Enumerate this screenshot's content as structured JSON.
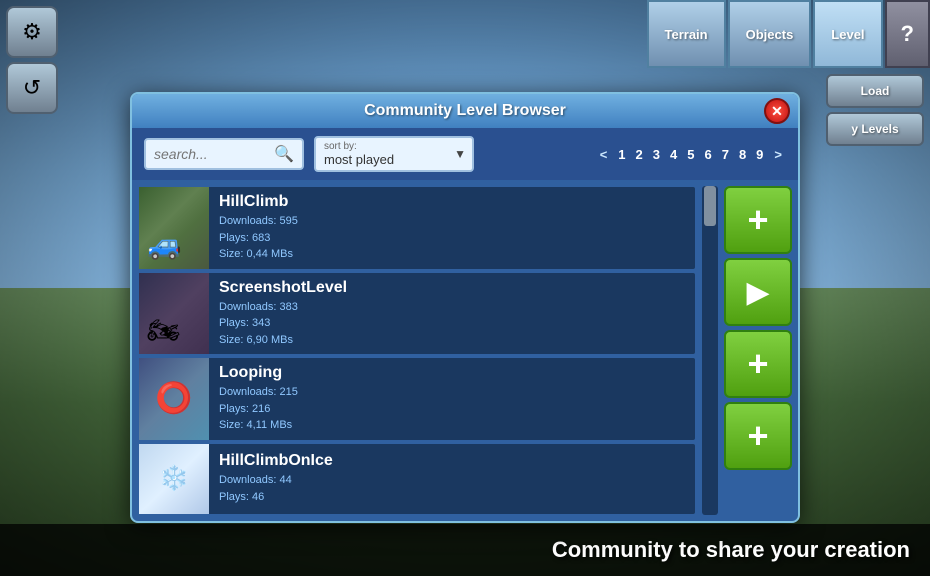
{
  "toolbar": {
    "terrain_label": "Terrain",
    "objects_label": "Objects",
    "level_label": "Level",
    "help_label": "?"
  },
  "sidebar": {
    "gear_icon": "⚙",
    "refresh_icon": "↺"
  },
  "right_panel": {
    "load_label": "Load",
    "my_levels_label": "y Levels"
  },
  "modal": {
    "title": "Community Level Browser",
    "close_label": "✕",
    "search_placeholder": "search...",
    "sort_label": "sort by:",
    "sort_value": "most played",
    "pagination": {
      "prev": "<",
      "pages": [
        "1",
        "2",
        "3",
        "4",
        "5",
        "6",
        "7",
        "8",
        "9"
      ],
      "next": ">"
    }
  },
  "levels": [
    {
      "name": "HillClimb",
      "downloads": "Downloads: 595",
      "plays": "Plays: 683",
      "size": "Size: 0,44 MBs",
      "thumb_class": "thumb-hillclimb"
    },
    {
      "name": "ScreenshotLevel",
      "downloads": "Downloads: 383",
      "plays": "Plays: 343",
      "size": "Size: 6,90 MBs",
      "thumb_class": "thumb-screenshot"
    },
    {
      "name": "Looping",
      "downloads": "Downloads: 215",
      "plays": "Plays: 216",
      "size": "Size: 4,11 MBs",
      "thumb_class": "thumb-looping"
    },
    {
      "name": "HillClimbOnIce",
      "downloads": "Downloads: 44",
      "plays": "Plays: 46",
      "size": "",
      "thumb_class": "thumb-hillclimbice"
    }
  ],
  "action_buttons": {
    "add1_label": "+",
    "play_label": "▶",
    "add2_label": "+",
    "add3_label": "+"
  },
  "status_bar": {
    "text": "Community to share your creation"
  }
}
